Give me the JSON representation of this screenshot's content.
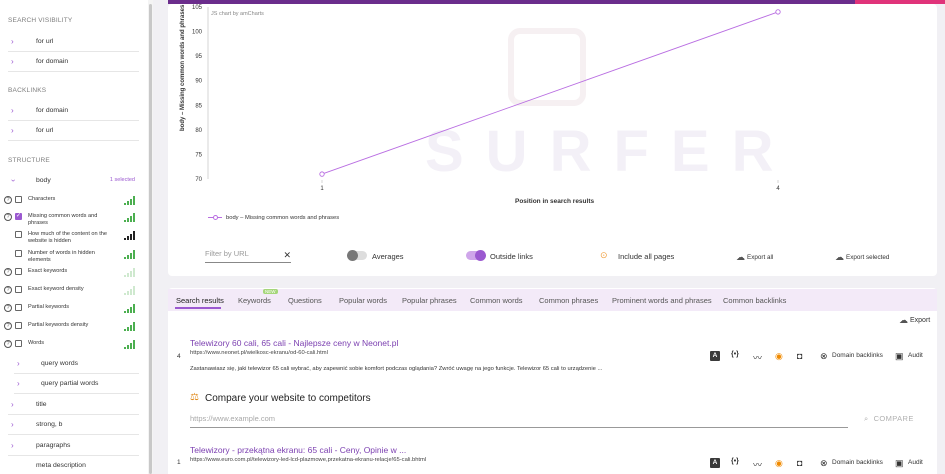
{
  "sidebar": {
    "sections": {
      "search_visibility": "SEARCH VISIBILITY",
      "backlinks": "BACKLINKS",
      "structure": "STRUCTURE"
    },
    "search_visibility_items": [
      "for url",
      "for domain"
    ],
    "backlinks_items": [
      "for domain",
      "for url"
    ],
    "body": {
      "label": "body",
      "selected": "1 selected"
    },
    "body_children": [
      {
        "label": "Characters",
        "checked": false,
        "help": true
      },
      {
        "label": "Missing common words and phrases",
        "checked": true,
        "help": true
      },
      {
        "label": "How much of the content on the website is hidden",
        "checked": false,
        "help": false
      },
      {
        "label": "Number of words in hidden elements",
        "checked": false,
        "help": false
      },
      {
        "label": "Exact keywords",
        "checked": false,
        "help": true
      },
      {
        "label": "Exact keyword density",
        "checked": false,
        "help": true
      },
      {
        "label": "Partial keywords",
        "checked": false,
        "help": true
      },
      {
        "label": "Partial keywords density",
        "checked": false,
        "help": true
      },
      {
        "label": "Words",
        "checked": false,
        "help": true
      }
    ],
    "words_children": [
      "query words",
      "query partial words"
    ],
    "more_items": [
      "title",
      "strong, b",
      "paragraphs",
      "meta description"
    ]
  },
  "chart_data": {
    "type": "line",
    "x": [
      1,
      4
    ],
    "series": [
      {
        "name": "body – Missing common words and phrases",
        "values": [
          71,
          104
        ]
      }
    ],
    "x_ticks": [
      "1",
      "4"
    ],
    "y_ticks": [
      70,
      75,
      80,
      85,
      90,
      95,
      100,
      105
    ],
    "ylim": [
      70,
      105
    ],
    "xlabel": "Position in search results",
    "ylabel": "body – Missing common words and phrases",
    "credit": "JS chart by amCharts",
    "watermark": "SURFER",
    "color": "#b96ee2"
  },
  "controls": {
    "filter_placeholder": "Filter by URL",
    "clear_icon": "✕",
    "averages": "Averages",
    "averages_on": false,
    "outside_links": "Outside links",
    "outside_links_on": true,
    "include_all_pages": "Include all pages",
    "export_all": "Export all",
    "export_selected": "Export selected"
  },
  "tabs": [
    "Search results",
    "Keywords",
    "Questions",
    "Popular words",
    "Popular phrases",
    "Common words",
    "Common phrases",
    "Prominent words and phrases",
    "Common backlinks"
  ],
  "new_badge": "NEW",
  "export_label": "Export",
  "results": [
    {
      "position": "4",
      "title": "Telewizory 60 cali, 65 cali - Najlepsze ceny w Neonet.pl",
      "url": "https://www.neonet.pl/wielkosc-ekranu/od-60-cali.html",
      "description": "Zastanawiasz się, jaki telewizor 65 cali wybrać, aby zapewnić sobie komfort podczas oglądania? Zwróć uwagę na jego funkcje. Telewizor 65 cali to urządzenie ..."
    },
    {
      "position": "1",
      "title": "Telewizory - przekątna ekranu: 65 cali - Ceny, Opinie w ...",
      "url": "https://www.euro.com.pl/telewizory-led-lcd-plazmowe,przekatna-ekranu-relacje!65-cali.bhtml"
    }
  ],
  "result_actions": {
    "domain_backlinks": "Domain backlinks",
    "audit": "Audit",
    "text_icon": "A",
    "code_icon": "{•}"
  },
  "compare": {
    "title": "Compare your website to competitors",
    "placeholder": "https://www.example.com",
    "button": "COMPARE"
  }
}
